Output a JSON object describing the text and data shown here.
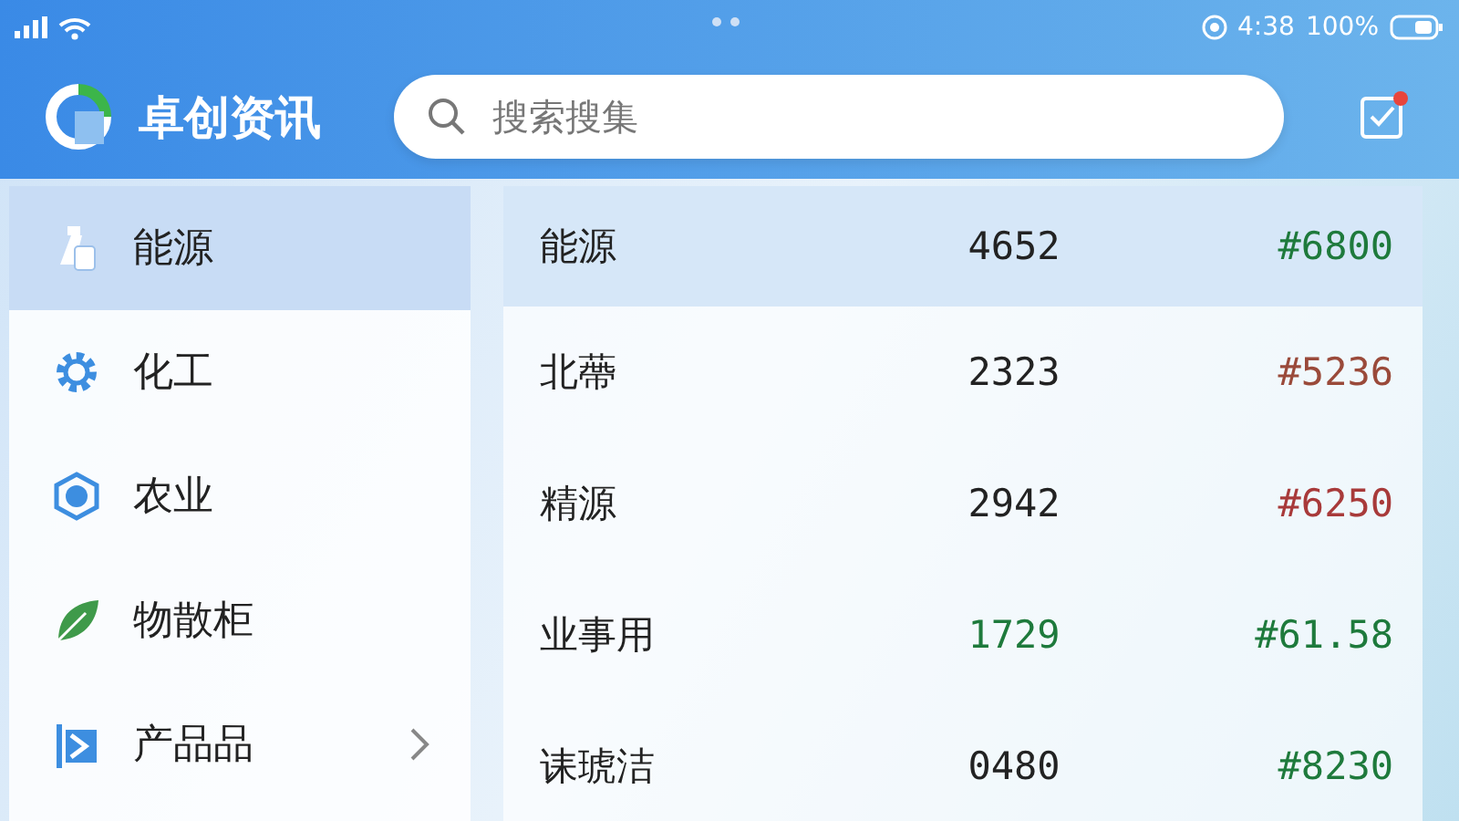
{
  "status_bar": {
    "time": "4:38",
    "battery": "100%"
  },
  "header": {
    "title": "卓创资讯",
    "search": {
      "placeholder": "搜索搜集"
    },
    "notification": true
  },
  "sidebar": {
    "items": [
      {
        "label": "能源",
        "selected": true,
        "has_submenu": false
      },
      {
        "label": "化工",
        "selected": false,
        "has_submenu": false
      },
      {
        "label": "农业",
        "selected": false,
        "has_submenu": false
      },
      {
        "label": "物散柜",
        "selected": false,
        "has_submenu": false
      },
      {
        "label": "产品品",
        "selected": false,
        "has_submenu": true
      }
    ]
  },
  "list": {
    "rows": [
      {
        "name": "能源",
        "value": {
          "text": "4652",
          "color": "#222222"
        },
        "price": {
          "text": "#6800",
          "color": "#1e7a3c"
        },
        "selected": true
      },
      {
        "name": "北蔕",
        "value": {
          "text": "2323",
          "color": "#222222"
        },
        "price": {
          "text": "#5236",
          "color": "#9a4a3a"
        },
        "selected": false
      },
      {
        "name": "精源",
        "value": {
          "text": "2942",
          "color": "#222222"
        },
        "price": {
          "text": "#6250",
          "color": "#a83a3a"
        },
        "selected": false
      },
      {
        "name": "业事用",
        "value": {
          "text": "1729",
          "color": "#1e7a3c"
        },
        "price": {
          "text": "#61.58",
          "color": "#1e7a3c"
        },
        "selected": false
      },
      {
        "name": "诔琥洁",
        "value": {
          "text": "0480",
          "color": "#222222"
        },
        "price": {
          "text": "#8230",
          "color": "#1e7a3c"
        },
        "selected": false
      }
    ]
  }
}
